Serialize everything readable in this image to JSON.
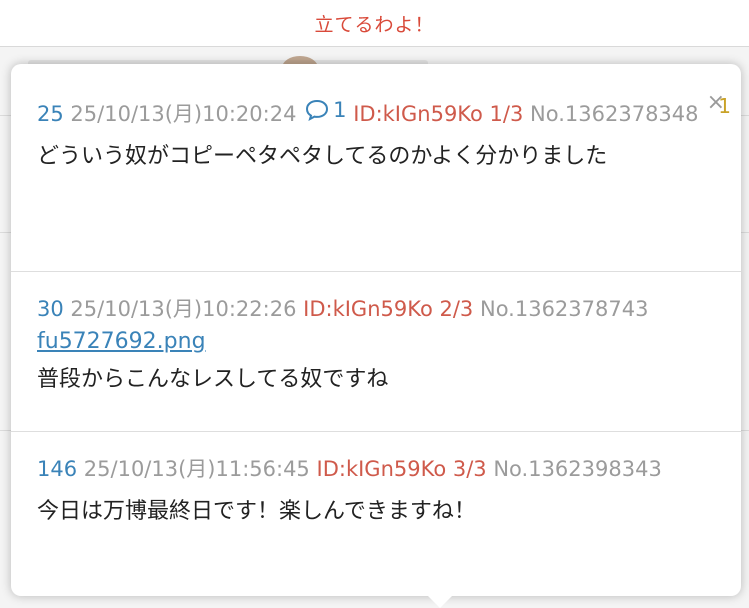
{
  "topbar": {
    "title": "立てるわよ！"
  },
  "popup": {
    "close_glyph": "×",
    "posts": [
      {
        "num": "25",
        "date": "25/10/13(月)10:20:24",
        "reply_count": "1",
        "id": "ID:kIGn59Ko 1/3",
        "no": "No.1362378348",
        "quote_marker": "1",
        "body": "どういう奴がコピーペタペタしてるのかよく分かりました"
      },
      {
        "num": "30",
        "date": "25/10/13(月)10:22:26",
        "id": "ID:kIGn59Ko 2/3",
        "no": "No.1362378743",
        "file": "fu5727692.png",
        "body": "普段からこんなレスしてる奴ですね"
      },
      {
        "num": "146",
        "date": "25/10/13(月)11:56:45",
        "id": "ID:kIGn59Ko 3/3",
        "no": "No.1362398343",
        "body": "今日は万博最終日です！楽しんできますね！"
      }
    ]
  }
}
